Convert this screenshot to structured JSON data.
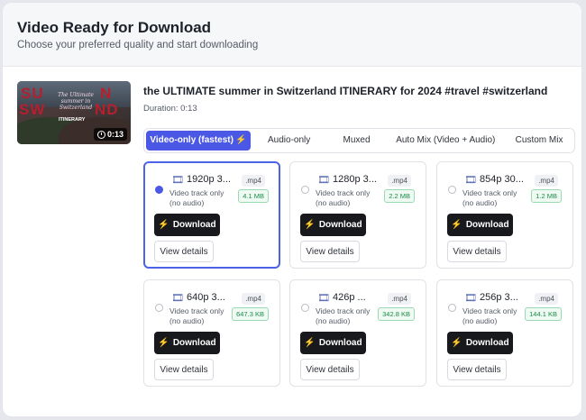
{
  "header": {
    "title": "Video Ready for Download",
    "subtitle": "Choose your preferred quality and start downloading"
  },
  "video": {
    "title": "the ULTIMATE summer in Switzerland ITINERARY for 2024 #travel #switzerland",
    "duration_label": "Duration: 0:13",
    "thumb_duration": "0:13",
    "thumb_text": {
      "big_left": "SU",
      "big_left2": "SW",
      "big_right": "N",
      "big_right2": "ND",
      "script": "The Ultimate summer in Switzerland",
      "itinerary": "ITINERARY"
    }
  },
  "tabs": [
    {
      "label": "Video-only (fastest)",
      "active": true,
      "icon": "lightning-icon"
    },
    {
      "label": "Audio-only",
      "active": false
    },
    {
      "label": "Muxed",
      "active": false
    },
    {
      "label": "Auto Mix (Video + Audio)",
      "active": false
    },
    {
      "label": "Custom Mix",
      "active": false
    }
  ],
  "cards": [
    {
      "resolution": "1920p 3...",
      "format": ".mp4",
      "line1": "Video track only",
      "line2": "(no audio)",
      "size": "4.1 MB",
      "selected": true
    },
    {
      "resolution": "1280p 3...",
      "format": ".mp4",
      "line1": "Video track only",
      "line2": "(no audio)",
      "size": "2.2 MB",
      "selected": false
    },
    {
      "resolution": "854p 30...",
      "format": ".mp4",
      "line1": "Video track only",
      "line2": "(no audio)",
      "size": "1.2 MB",
      "selected": false
    },
    {
      "resolution": "640p 3...",
      "format": ".mp4",
      "line1": "Video track only",
      "line2": "(no audio)",
      "size": "647.3 KB",
      "selected": false
    },
    {
      "resolution": "426p ...",
      "format": ".mp4",
      "line1": "Video track only",
      "line2": "(no audio)",
      "size": "342.8 KB",
      "selected": false
    },
    {
      "resolution": "256p 3...",
      "format": ".mp4",
      "line1": "Video track only",
      "line2": "(no audio)",
      "size": "144.1 KB",
      "selected": false
    }
  ],
  "labels": {
    "download": "Download",
    "view_details": "View details"
  },
  "colors": {
    "accent": "#4b58e6",
    "download_bg": "#18191c",
    "size_green": "#1b8c49"
  }
}
